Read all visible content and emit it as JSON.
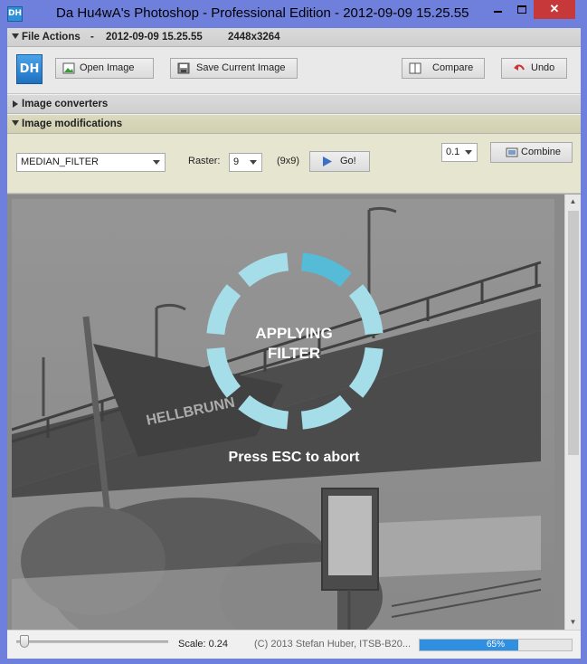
{
  "window": {
    "title": "Da Hu4wA's Photoshop - Professional Edition  - 2012-09-09 15.25.55",
    "icon_text": "DH",
    "minimize_icon": "minimize-icon",
    "maximize_icon": "maximize-icon",
    "close_icon": "close-icon",
    "close_glyph": "✕"
  },
  "file_actions": {
    "header_label": "File Actions",
    "separator": "-",
    "file_date": "2012-09-09 15.25.55",
    "dimensions": "2448x3264",
    "logo_text": "DH",
    "open_label": "Open Image",
    "save_label": "Save Current Image",
    "compare_label": "Compare",
    "undo_label": "Undo"
  },
  "image_converters": {
    "header_label": "Image converters"
  },
  "image_modifications": {
    "header_label": "Image modifications",
    "filter_selected": "MEDIAN_FILTER",
    "raster_label": "Raster:",
    "raster_selected": "9",
    "raster_dims": "(9x9)",
    "go_label": "Go!",
    "opacity_selected": "0.1",
    "combine_label": "Combine"
  },
  "overlay": {
    "line1": "APPLYING",
    "line2": "FILTER",
    "hint": "Press ESC to abort"
  },
  "statusbar": {
    "scale_text": "Scale: 0.24",
    "copyright": "(C) 2013 Stefan Huber, ITSB-B20...",
    "progress_text": "65%",
    "progress_value": 0.65
  },
  "colors": {
    "accent": "#2f8fe0",
    "spinner": "#a5dde8",
    "spinner_active": "#55bbd6"
  }
}
